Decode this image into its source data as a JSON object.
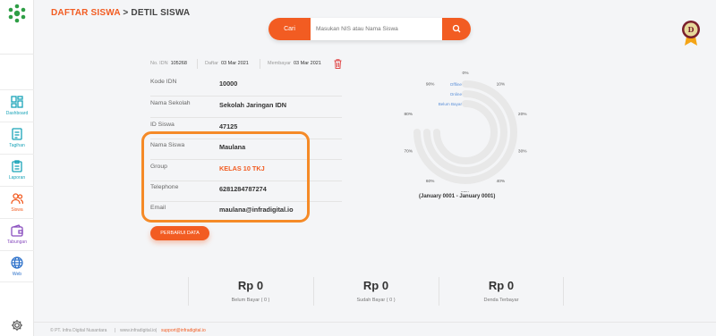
{
  "header": {
    "breadcrumb_root": "DAFTAR SISWA",
    "breadcrumb_sep": ">",
    "breadcrumb_current": "DETIL SISWA"
  },
  "search": {
    "label": "Cari",
    "placeholder": "Masukan NIS atau Nama Siswa"
  },
  "sidebar": {
    "items": [
      {
        "label": "Dashboard",
        "icon": "dashboard-icon",
        "color": "#19a3b8"
      },
      {
        "label": "Tagihan",
        "icon": "invoice-icon",
        "color": "#19a3b8"
      },
      {
        "label": "Laporan",
        "icon": "report-icon",
        "color": "#19a3b8"
      },
      {
        "label": "Siswa",
        "icon": "users-icon",
        "color": "#f25c22"
      },
      {
        "label": "Tabungan",
        "icon": "wallet-icon",
        "color": "#8a4fbf"
      },
      {
        "label": "Web",
        "icon": "globe-icon",
        "color": "#2a6fc9"
      }
    ]
  },
  "meta": {
    "no_idn_label": "No. IDN",
    "no_idn": "105268",
    "daftar_label": "Daftar",
    "daftar": "03 Mar 2021",
    "membayar_label": "Membayar",
    "membayar": "03 Mar 2021"
  },
  "fields": [
    {
      "label": "Kode IDN",
      "value": "10000"
    },
    {
      "label": "Nama Sekolah",
      "value": "Sekolah Jaringan IDN"
    },
    {
      "label": "ID Siswa",
      "value": "47125"
    },
    {
      "label": "Nama Siswa",
      "value": "Maulana"
    },
    {
      "label": "Group",
      "value": "KELAS 10 TKJ"
    },
    {
      "label": "Telephone",
      "value": "6281284787274"
    },
    {
      "label": "Email",
      "value": "maulana@infradigital.io"
    }
  ],
  "update_button": "PERBARUI DATA",
  "chart_data": {
    "type": "radial-bar",
    "series": [
      {
        "name": "Offline",
        "value": 0
      },
      {
        "name": "Online",
        "value": 0
      },
      {
        "name": "Belum Bayar",
        "value": 0
      }
    ],
    "ticks": [
      "0%",
      "10%",
      "20%",
      "30%",
      "40%",
      "50%",
      "60%",
      "70%",
      "80%",
      "90%"
    ],
    "period": "(January 0001 - January 0001)",
    "colors": {
      "track": "#e8e8e8",
      "label": "#5a8fd8"
    }
  },
  "summary": [
    {
      "amount": "Rp 0",
      "caption": "Belum Bayar ( 0 )"
    },
    {
      "amount": "Rp 0",
      "caption": "Sudah Bayar ( 0 )"
    },
    {
      "amount": "Rp 0",
      "caption": "Denda Terbayar"
    }
  ],
  "footer": {
    "copyright": "© PT. Infra Digital Nusantara",
    "site": "www.infradigital.io",
    "email": "support@infradigital.io"
  },
  "colors": {
    "accent": "#f25c22",
    "highlight": "#f58a27"
  }
}
